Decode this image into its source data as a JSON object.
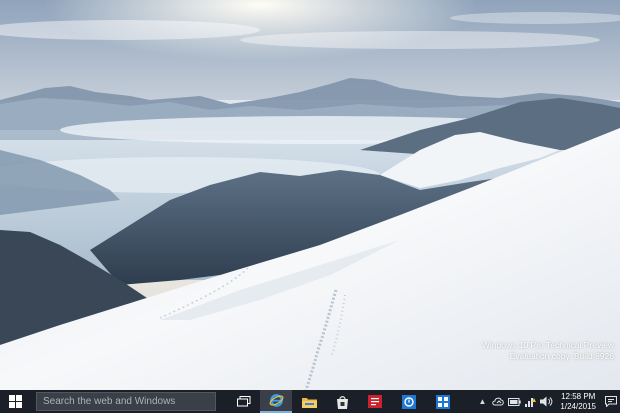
{
  "watermark": {
    "line1": "Windows 10 Pro Technical Preview",
    "line2": "Evaluation copy. Build 9926"
  },
  "taskbar": {
    "search_placeholder": "Search the web and Windows",
    "apps": [
      {
        "name": "task-view",
        "icon": "task-view-icon"
      },
      {
        "name": "internet-explorer",
        "icon": "internet-explorer-icon"
      },
      {
        "name": "file-explorer",
        "icon": "folder-icon"
      },
      {
        "name": "store",
        "icon": "store-icon"
      },
      {
        "name": "app-red",
        "icon": "red-app-icon"
      },
      {
        "name": "app-blue",
        "icon": "blue-app-icon"
      },
      {
        "name": "app-blue-grid",
        "icon": "grid-app-icon"
      }
    ],
    "tray": {
      "time": "12:58 PM",
      "date": "1/24/2015"
    }
  },
  "colors": {
    "taskbar": "#1b1f28",
    "accent": "#7eb0e6",
    "sky_top": "#8fa5bd",
    "snow": "#f4f6f8"
  }
}
